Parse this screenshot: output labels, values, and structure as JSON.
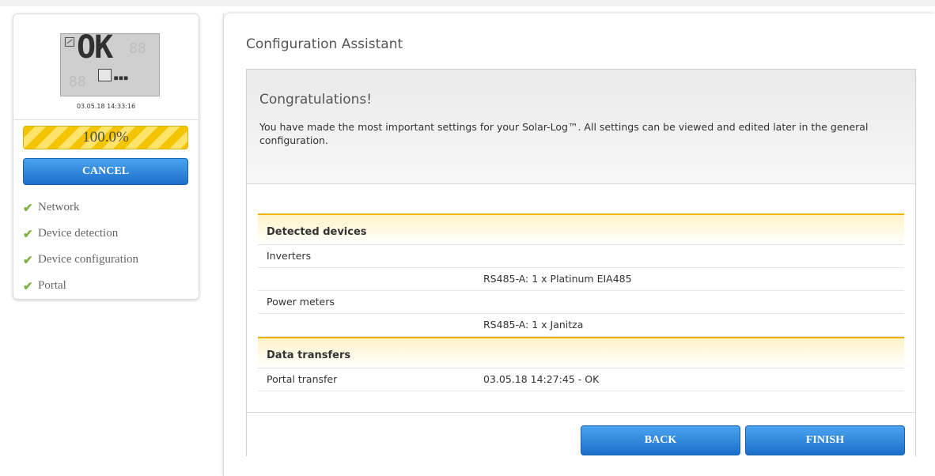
{
  "sidebar": {
    "display": {
      "lcd_text": "OK",
      "datetime": "03.05.18 14:33:16"
    },
    "progress": {
      "label": "100.0%",
      "value_percent": 100
    },
    "cancel_label": "CANCEL",
    "steps": [
      {
        "label": "Network",
        "status": "done"
      },
      {
        "label": "Device detection",
        "status": "done"
      },
      {
        "label": "Device configuration",
        "status": "done"
      },
      {
        "label": "Portal",
        "status": "done"
      }
    ]
  },
  "main": {
    "title": "Configuration Assistant",
    "panel": {
      "heading": "Congratulations!",
      "text": "You have made the most important settings for your Solar-Log™. All settings can be viewed and edited later in the general configuration.",
      "sections": [
        {
          "title": "Detected devices",
          "rows": [
            {
              "label": "Inverters",
              "value": ""
            },
            {
              "label": "",
              "value": "RS485-A: 1 x Platinum EIA485"
            },
            {
              "label": "Power meters",
              "value": ""
            },
            {
              "label": "",
              "value": "RS485-A: 1 x Janitza"
            }
          ]
        },
        {
          "title": "Data transfers",
          "rows": [
            {
              "label": "Portal transfer",
              "value": "03.05.18 14:27:45 - OK"
            }
          ]
        }
      ],
      "back_label": "BACK",
      "finish_label": "FINISH"
    }
  },
  "colors": {
    "accent_blue": "#1c6fc9",
    "progress_yellow": "#ffd200",
    "check_green": "#7cb342",
    "section_border": "#f0b400"
  }
}
